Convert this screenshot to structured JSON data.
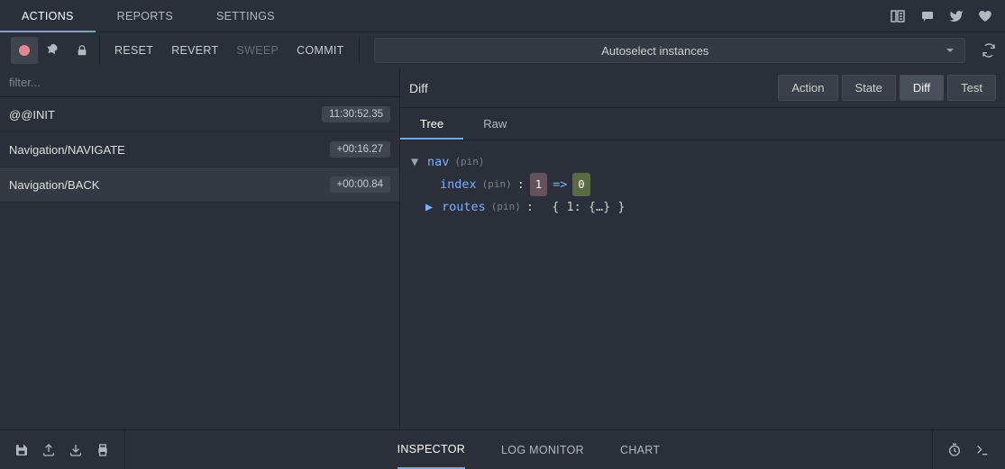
{
  "top_tabs": {
    "actions": "ACTIONS",
    "reports": "REPORTS",
    "settings": "SETTINGS"
  },
  "toolbar": {
    "reset": "RESET",
    "revert": "REVERT",
    "sweep": "SWEEP",
    "commit": "COMMIT"
  },
  "instances": {
    "label": "Autoselect instances"
  },
  "filter": {
    "placeholder": "filter..."
  },
  "actions": [
    {
      "name": "@@INIT",
      "time": "11:30:52.35"
    },
    {
      "name": "Navigation/NAVIGATE",
      "time": "+00:16.27"
    },
    {
      "name": "Navigation/BACK",
      "time": "+00:00.84"
    }
  ],
  "panel": {
    "title": "Diff",
    "view_buttons": {
      "action": "Action",
      "state": "State",
      "diff": "Diff",
      "test": "Test"
    },
    "subtabs": {
      "tree": "Tree",
      "raw": "Raw"
    }
  },
  "diff": {
    "root": "nav",
    "pin": "(pin)",
    "index_key": "index",
    "index_old": "1",
    "index_arrow": "=>",
    "index_new": "0",
    "routes_key": "routes",
    "routes_val": "{ 1: {…} }"
  },
  "bottom_tabs": {
    "inspector": "INSPECTOR",
    "log_monitor": "LOG MONITOR",
    "chart": "CHART"
  }
}
